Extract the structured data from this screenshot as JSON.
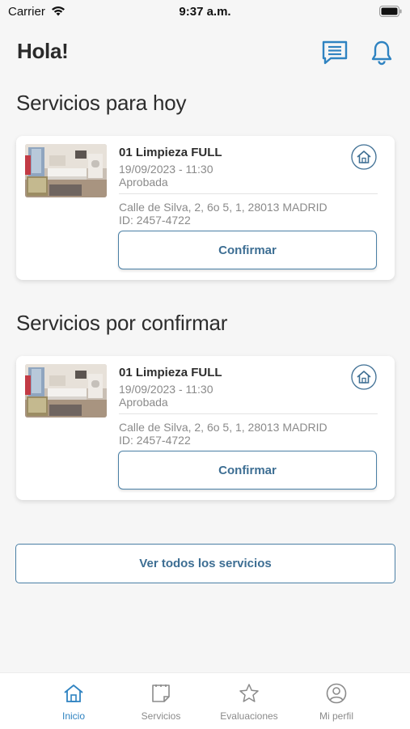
{
  "status_bar": {
    "carrier": "Carrier",
    "time": "9:37 a.m."
  },
  "header": {
    "greeting": "Hola!",
    "icons": [
      "message-icon",
      "bell-icon"
    ]
  },
  "sections": {
    "today": {
      "title": "Servicios para hoy",
      "card": {
        "service": "01 Limpieza FULL",
        "datetime": "19/09/2023 - 11:30",
        "status": "Aprobada",
        "address": "Calle de Silva, 2, 6o 5, 1, 28013 MADRID",
        "id": "ID: 2457-4722",
        "button": "Confirmar"
      }
    },
    "pending": {
      "title": "Servicios por confirmar",
      "card": {
        "service": "01 Limpieza FULL",
        "datetime": "19/09/2023 - 11:30",
        "status": "Aprobada",
        "address": "Calle de Silva, 2, 6o 5, 1, 28013 MADRID",
        "id": "ID: 2457-4722",
        "button": "Confirmar"
      }
    }
  },
  "all_services_button": "Ver todos los servicios",
  "tabbar": {
    "items": [
      {
        "label": "Inicio",
        "icon": "home-icon",
        "active": true
      },
      {
        "label": "Servicios",
        "icon": "notepad-icon",
        "active": false
      },
      {
        "label": "Evaluaciones",
        "icon": "star-icon",
        "active": false
      },
      {
        "label": "Mi perfil",
        "icon": "user-circle-icon",
        "active": false
      }
    ]
  },
  "colors": {
    "accent": "#3d6e93",
    "icon_blue": "#2f83c1",
    "background": "#f6f6f6"
  }
}
